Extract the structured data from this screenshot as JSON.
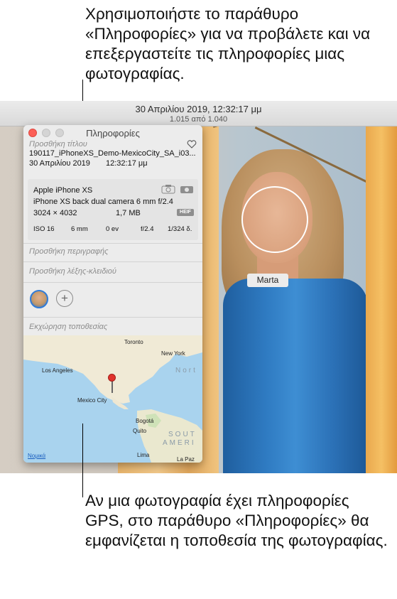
{
  "callouts": {
    "top": "Χρησιμοποιήστε το παράθυρο «Πληροφορίες» για να προβάλετε και να επεξεργαστείτε τις πληροφορίες μιας φωτογραφίας.",
    "bottom": "Αν μια φωτογραφία έχει πληροφορίες GPS, στο παράθυρο «Πληροφορίες» θα εμφανίζεται η τοποθεσία της φωτογραφίας."
  },
  "window": {
    "date": "30 Απριλίου 2019, 12:32:17 μμ",
    "count": "1.015 από 1.040"
  },
  "photo": {
    "face_label": "Marta"
  },
  "info": {
    "title": "Πληροφορίες",
    "add_title_placeholder": "Προσθήκη τίτλου",
    "filename": "190117_iPhoneXS_Demo-MexicoCity_SA_i03...",
    "date": "30 Απριλίου 2019",
    "time": "12:32:17 μμ",
    "camera": "Apple iPhone XS",
    "lens": "iPhone XS back dual camera 6 mm f/2.4",
    "resolution": "3024 × 4032",
    "size": "1,7 MB",
    "format": "HEIF",
    "exif": {
      "iso": "ISO 16",
      "focal": "6 mm",
      "ev": "0 ev",
      "aperture": "f/2.4",
      "shutter": "1/324 δ."
    },
    "add_description_placeholder": "Προσθήκη περιγραφής",
    "add_keyword_placeholder": "Προσθήκη λέξης-κλειδιού",
    "add_person_label": "+",
    "location_placeholder": "Εκχώρηση τοποθεσίας"
  },
  "map": {
    "cities": {
      "toronto": "Toronto",
      "new_york": "New York",
      "los_angeles": "Los Angeles",
      "mexico_city": "Mexico City",
      "bogota": "Bogotá",
      "quito": "Quito",
      "lima": "Lima",
      "la_paz": "La Paz"
    },
    "region_north": "Nort",
    "region_south_1": "SOUT",
    "region_south_2": "AMERI",
    "legal": "Νομικά"
  },
  "colors": {
    "close": "#fc5f57",
    "pin": "#e0332c",
    "ocean": "#a9d3ee",
    "land": "#f0ead6",
    "avatar_ring": "#2f7bd9"
  }
}
